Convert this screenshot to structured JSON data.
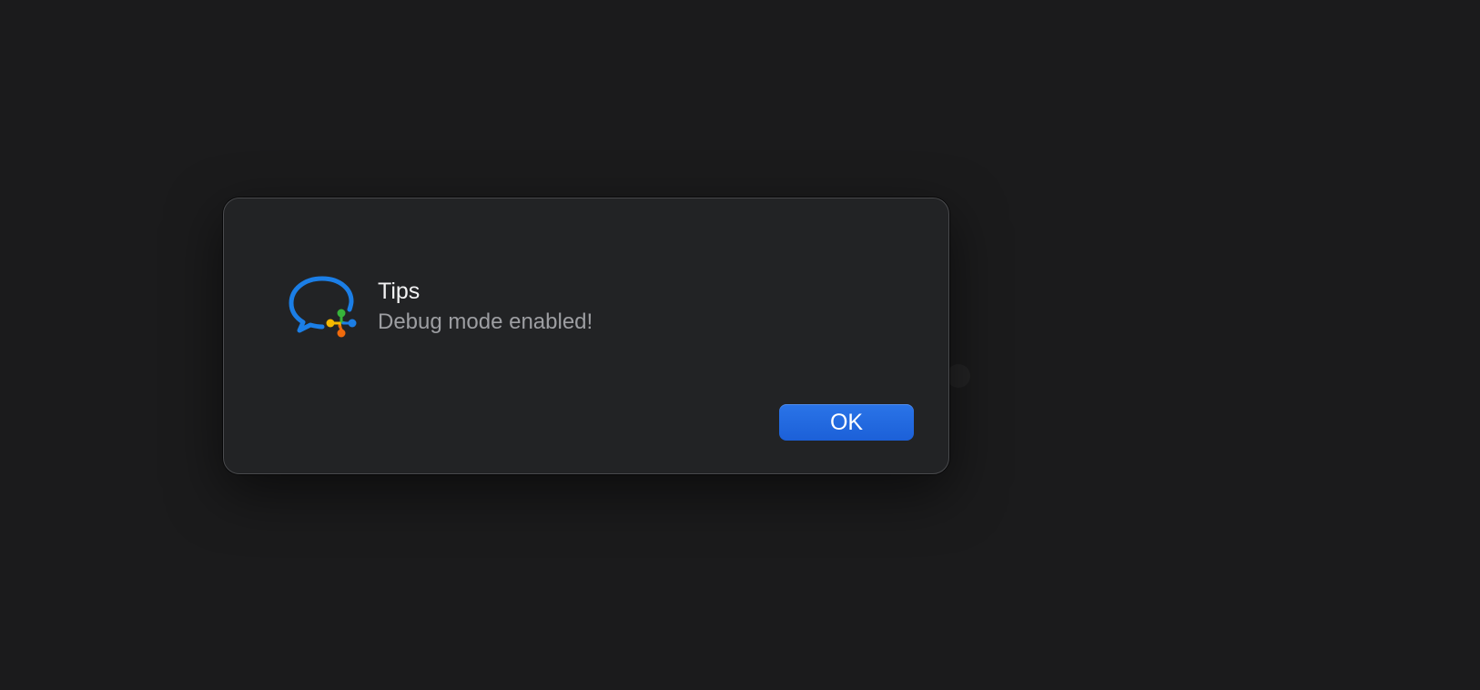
{
  "dialog": {
    "title": "Tips",
    "message": "Debug mode enabled!",
    "ok_label": "OK",
    "icon": "wecom-chat-bubble-icon"
  },
  "colors": {
    "background": "#1b1b1c",
    "dialog_background": "#222325",
    "accent_button": "#1f66dd",
    "icon_blue": "#1b7ee6",
    "icon_green": "#37b33a",
    "icon_yellow": "#f5b800",
    "icon_orange": "#f06a0c"
  }
}
